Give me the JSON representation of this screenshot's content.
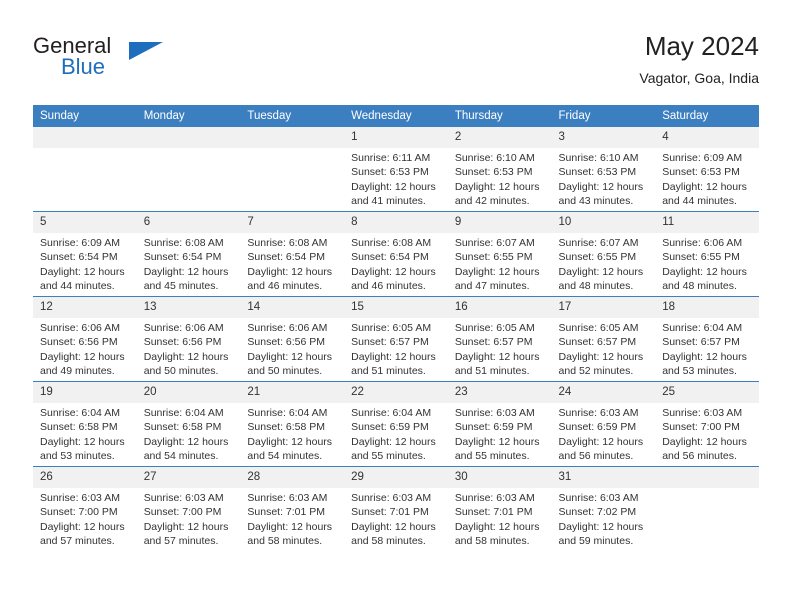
{
  "brand": {
    "name_top": "General",
    "name_bottom": "Blue",
    "accent_color": "#1f6ebd"
  },
  "header": {
    "title": "May 2024",
    "subtitle": "Vagator, Goa, India"
  },
  "theme": {
    "header_bar_color": "#3c7fc1",
    "daynum_band_color": "#f1f1f1",
    "text_color": "#333333"
  },
  "weekdays": [
    "Sunday",
    "Monday",
    "Tuesday",
    "Wednesday",
    "Thursday",
    "Friday",
    "Saturday"
  ],
  "weeks": [
    [
      {
        "day": "",
        "empty": true,
        "sunrise": "",
        "sunset": "",
        "daylight1": "",
        "daylight2": ""
      },
      {
        "day": "",
        "empty": true,
        "sunrise": "",
        "sunset": "",
        "daylight1": "",
        "daylight2": ""
      },
      {
        "day": "",
        "empty": true,
        "sunrise": "",
        "sunset": "",
        "daylight1": "",
        "daylight2": ""
      },
      {
        "day": "1",
        "sunrise": "Sunrise: 6:11 AM",
        "sunset": "Sunset: 6:53 PM",
        "daylight1": "Daylight: 12 hours",
        "daylight2": "and 41 minutes."
      },
      {
        "day": "2",
        "sunrise": "Sunrise: 6:10 AM",
        "sunset": "Sunset: 6:53 PM",
        "daylight1": "Daylight: 12 hours",
        "daylight2": "and 42 minutes."
      },
      {
        "day": "3",
        "sunrise": "Sunrise: 6:10 AM",
        "sunset": "Sunset: 6:53 PM",
        "daylight1": "Daylight: 12 hours",
        "daylight2": "and 43 minutes."
      },
      {
        "day": "4",
        "sunrise": "Sunrise: 6:09 AM",
        "sunset": "Sunset: 6:53 PM",
        "daylight1": "Daylight: 12 hours",
        "daylight2": "and 44 minutes."
      }
    ],
    [
      {
        "day": "5",
        "sunrise": "Sunrise: 6:09 AM",
        "sunset": "Sunset: 6:54 PM",
        "daylight1": "Daylight: 12 hours",
        "daylight2": "and 44 minutes."
      },
      {
        "day": "6",
        "sunrise": "Sunrise: 6:08 AM",
        "sunset": "Sunset: 6:54 PM",
        "daylight1": "Daylight: 12 hours",
        "daylight2": "and 45 minutes."
      },
      {
        "day": "7",
        "sunrise": "Sunrise: 6:08 AM",
        "sunset": "Sunset: 6:54 PM",
        "daylight1": "Daylight: 12 hours",
        "daylight2": "and 46 minutes."
      },
      {
        "day": "8",
        "sunrise": "Sunrise: 6:08 AM",
        "sunset": "Sunset: 6:54 PM",
        "daylight1": "Daylight: 12 hours",
        "daylight2": "and 46 minutes."
      },
      {
        "day": "9",
        "sunrise": "Sunrise: 6:07 AM",
        "sunset": "Sunset: 6:55 PM",
        "daylight1": "Daylight: 12 hours",
        "daylight2": "and 47 minutes."
      },
      {
        "day": "10",
        "sunrise": "Sunrise: 6:07 AM",
        "sunset": "Sunset: 6:55 PM",
        "daylight1": "Daylight: 12 hours",
        "daylight2": "and 48 minutes."
      },
      {
        "day": "11",
        "sunrise": "Sunrise: 6:06 AM",
        "sunset": "Sunset: 6:55 PM",
        "daylight1": "Daylight: 12 hours",
        "daylight2": "and 48 minutes."
      }
    ],
    [
      {
        "day": "12",
        "sunrise": "Sunrise: 6:06 AM",
        "sunset": "Sunset: 6:56 PM",
        "daylight1": "Daylight: 12 hours",
        "daylight2": "and 49 minutes."
      },
      {
        "day": "13",
        "sunrise": "Sunrise: 6:06 AM",
        "sunset": "Sunset: 6:56 PM",
        "daylight1": "Daylight: 12 hours",
        "daylight2": "and 50 minutes."
      },
      {
        "day": "14",
        "sunrise": "Sunrise: 6:06 AM",
        "sunset": "Sunset: 6:56 PM",
        "daylight1": "Daylight: 12 hours",
        "daylight2": "and 50 minutes."
      },
      {
        "day": "15",
        "sunrise": "Sunrise: 6:05 AM",
        "sunset": "Sunset: 6:57 PM",
        "daylight1": "Daylight: 12 hours",
        "daylight2": "and 51 minutes."
      },
      {
        "day": "16",
        "sunrise": "Sunrise: 6:05 AM",
        "sunset": "Sunset: 6:57 PM",
        "daylight1": "Daylight: 12 hours",
        "daylight2": "and 51 minutes."
      },
      {
        "day": "17",
        "sunrise": "Sunrise: 6:05 AM",
        "sunset": "Sunset: 6:57 PM",
        "daylight1": "Daylight: 12 hours",
        "daylight2": "and 52 minutes."
      },
      {
        "day": "18",
        "sunrise": "Sunrise: 6:04 AM",
        "sunset": "Sunset: 6:57 PM",
        "daylight1": "Daylight: 12 hours",
        "daylight2": "and 53 minutes."
      }
    ],
    [
      {
        "day": "19",
        "sunrise": "Sunrise: 6:04 AM",
        "sunset": "Sunset: 6:58 PM",
        "daylight1": "Daylight: 12 hours",
        "daylight2": "and 53 minutes."
      },
      {
        "day": "20",
        "sunrise": "Sunrise: 6:04 AM",
        "sunset": "Sunset: 6:58 PM",
        "daylight1": "Daylight: 12 hours",
        "daylight2": "and 54 minutes."
      },
      {
        "day": "21",
        "sunrise": "Sunrise: 6:04 AM",
        "sunset": "Sunset: 6:58 PM",
        "daylight1": "Daylight: 12 hours",
        "daylight2": "and 54 minutes."
      },
      {
        "day": "22",
        "sunrise": "Sunrise: 6:04 AM",
        "sunset": "Sunset: 6:59 PM",
        "daylight1": "Daylight: 12 hours",
        "daylight2": "and 55 minutes."
      },
      {
        "day": "23",
        "sunrise": "Sunrise: 6:03 AM",
        "sunset": "Sunset: 6:59 PM",
        "daylight1": "Daylight: 12 hours",
        "daylight2": "and 55 minutes."
      },
      {
        "day": "24",
        "sunrise": "Sunrise: 6:03 AM",
        "sunset": "Sunset: 6:59 PM",
        "daylight1": "Daylight: 12 hours",
        "daylight2": "and 56 minutes."
      },
      {
        "day": "25",
        "sunrise": "Sunrise: 6:03 AM",
        "sunset": "Sunset: 7:00 PM",
        "daylight1": "Daylight: 12 hours",
        "daylight2": "and 56 minutes."
      }
    ],
    [
      {
        "day": "26",
        "sunrise": "Sunrise: 6:03 AM",
        "sunset": "Sunset: 7:00 PM",
        "daylight1": "Daylight: 12 hours",
        "daylight2": "and 57 minutes."
      },
      {
        "day": "27",
        "sunrise": "Sunrise: 6:03 AM",
        "sunset": "Sunset: 7:00 PM",
        "daylight1": "Daylight: 12 hours",
        "daylight2": "and 57 minutes."
      },
      {
        "day": "28",
        "sunrise": "Sunrise: 6:03 AM",
        "sunset": "Sunset: 7:01 PM",
        "daylight1": "Daylight: 12 hours",
        "daylight2": "and 58 minutes."
      },
      {
        "day": "29",
        "sunrise": "Sunrise: 6:03 AM",
        "sunset": "Sunset: 7:01 PM",
        "daylight1": "Daylight: 12 hours",
        "daylight2": "and 58 minutes."
      },
      {
        "day": "30",
        "sunrise": "Sunrise: 6:03 AM",
        "sunset": "Sunset: 7:01 PM",
        "daylight1": "Daylight: 12 hours",
        "daylight2": "and 58 minutes."
      },
      {
        "day": "31",
        "sunrise": "Sunrise: 6:03 AM",
        "sunset": "Sunset: 7:02 PM",
        "daylight1": "Daylight: 12 hours",
        "daylight2": "and 59 minutes."
      },
      {
        "day": "",
        "empty": true,
        "sunrise": "",
        "sunset": "",
        "daylight1": "",
        "daylight2": ""
      }
    ]
  ]
}
